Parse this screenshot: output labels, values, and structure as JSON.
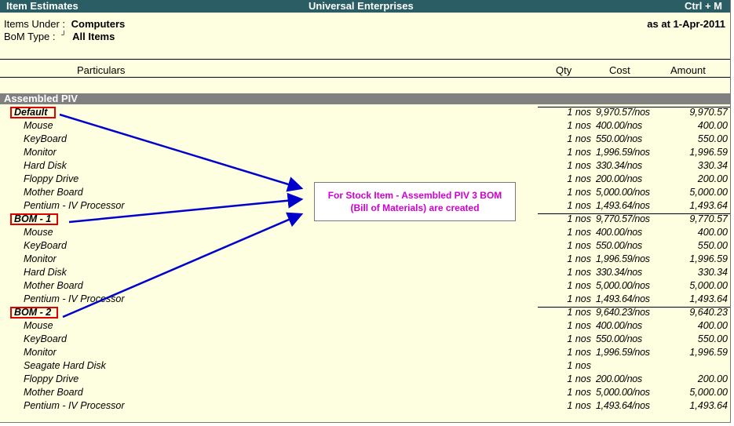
{
  "titlebar": {
    "left": "Item Estimates",
    "center": "Universal Enterprises",
    "right": "Ctrl + M"
  },
  "header": {
    "items_under_label": "Items Under :",
    "items_under_value": "Computers",
    "bom_type_label": "BoM Type :",
    "bom_type_marker": "┘",
    "bom_type_value": "All Items",
    "as_at": "as at 1-Apr-2011"
  },
  "columns": {
    "particulars": "Particulars",
    "qty": "Qty",
    "cost": "Cost",
    "amount": "Amount"
  },
  "group": "Assembled PIV",
  "note": {
    "line1": "For Stock Item - Assembled PIV 3 BOM",
    "line2": "(Bill of Materials) are created"
  },
  "rows": [
    {
      "type": "bom",
      "name": "Default",
      "qty": "1 nos",
      "cost": "9,970.57/nos",
      "amount": "9,970.57"
    },
    {
      "type": "item",
      "name": "Mouse",
      "qty": "1 nos",
      "cost": "400.00/nos",
      "amount": "400.00"
    },
    {
      "type": "item",
      "name": "KeyBoard",
      "qty": "1 nos",
      "cost": "550.00/nos",
      "amount": "550.00"
    },
    {
      "type": "item",
      "name": "Monitor",
      "qty": "1 nos",
      "cost": "1,996.59/nos",
      "amount": "1,996.59"
    },
    {
      "type": "item",
      "name": "Hard Disk",
      "qty": "1 nos",
      "cost": "330.34/nos",
      "amount": "330.34"
    },
    {
      "type": "item",
      "name": "Floppy Drive",
      "qty": "1 nos",
      "cost": "200.00/nos",
      "amount": "200.00"
    },
    {
      "type": "item",
      "name": "Mother Board",
      "qty": "1 nos",
      "cost": "5,000.00/nos",
      "amount": "5,000.00"
    },
    {
      "type": "item",
      "name": "Pentium - IV Processor",
      "qty": "1 nos",
      "cost": "1,493.64/nos",
      "amount": "1,493.64"
    },
    {
      "type": "bom",
      "name": "BOM - 1",
      "qty": "1 nos",
      "cost": "9,770.57/nos",
      "amount": "9,770.57"
    },
    {
      "type": "item",
      "name": "Mouse",
      "qty": "1 nos",
      "cost": "400.00/nos",
      "amount": "400.00"
    },
    {
      "type": "item",
      "name": "KeyBoard",
      "qty": "1 nos",
      "cost": "550.00/nos",
      "amount": "550.00"
    },
    {
      "type": "item",
      "name": "Monitor",
      "qty": "1 nos",
      "cost": "1,996.59/nos",
      "amount": "1,996.59"
    },
    {
      "type": "item",
      "name": "Hard Disk",
      "qty": "1 nos",
      "cost": "330.34/nos",
      "amount": "330.34"
    },
    {
      "type": "item",
      "name": "Mother Board",
      "qty": "1 nos",
      "cost": "5,000.00/nos",
      "amount": "5,000.00"
    },
    {
      "type": "item",
      "name": "Pentium - IV Processor",
      "qty": "1 nos",
      "cost": "1,493.64/nos",
      "amount": "1,493.64"
    },
    {
      "type": "bom",
      "name": "BOM - 2",
      "qty": "1 nos",
      "cost": "9,640.23/nos",
      "amount": "9,640.23"
    },
    {
      "type": "item",
      "name": "Mouse",
      "qty": "1 nos",
      "cost": "400.00/nos",
      "amount": "400.00"
    },
    {
      "type": "item",
      "name": "KeyBoard",
      "qty": "1 nos",
      "cost": "550.00/nos",
      "amount": "550.00"
    },
    {
      "type": "item",
      "name": "Monitor",
      "qty": "1 nos",
      "cost": "1,996.59/nos",
      "amount": "1,996.59"
    },
    {
      "type": "item",
      "name": "Seagate Hard Disk",
      "qty": "1 nos",
      "cost": "",
      "amount": ""
    },
    {
      "type": "item",
      "name": "Floppy Drive",
      "qty": "1 nos",
      "cost": "200.00/nos",
      "amount": "200.00"
    },
    {
      "type": "item",
      "name": "Mother Board",
      "qty": "1 nos",
      "cost": "5,000.00/nos",
      "amount": "5,000.00"
    },
    {
      "type": "item",
      "name": "Pentium - IV Processor",
      "qty": "1 nos",
      "cost": "1,493.64/nos",
      "amount": "1,493.64"
    }
  ],
  "colors": {
    "titlebar_bg": "#2a5e64",
    "background": "#fefee0",
    "group_bar": "#808080",
    "highlight_box": "#e00000",
    "arrow": "#0000cc",
    "note_text": "#d000d0"
  }
}
